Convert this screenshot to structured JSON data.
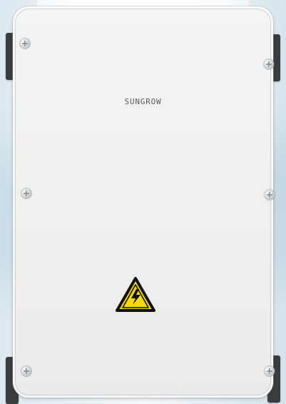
{
  "product": {
    "brand": "SUNGROW"
  },
  "colors": {
    "background": "#e7f0f5",
    "cabinet": "#efefef",
    "bracket": "#3a3d40",
    "brand_text": "#555a5e",
    "warning_fill": "#f5d90f",
    "warning_outline": "#111111"
  },
  "icons": {
    "warning": "high-voltage-warning-icon"
  }
}
